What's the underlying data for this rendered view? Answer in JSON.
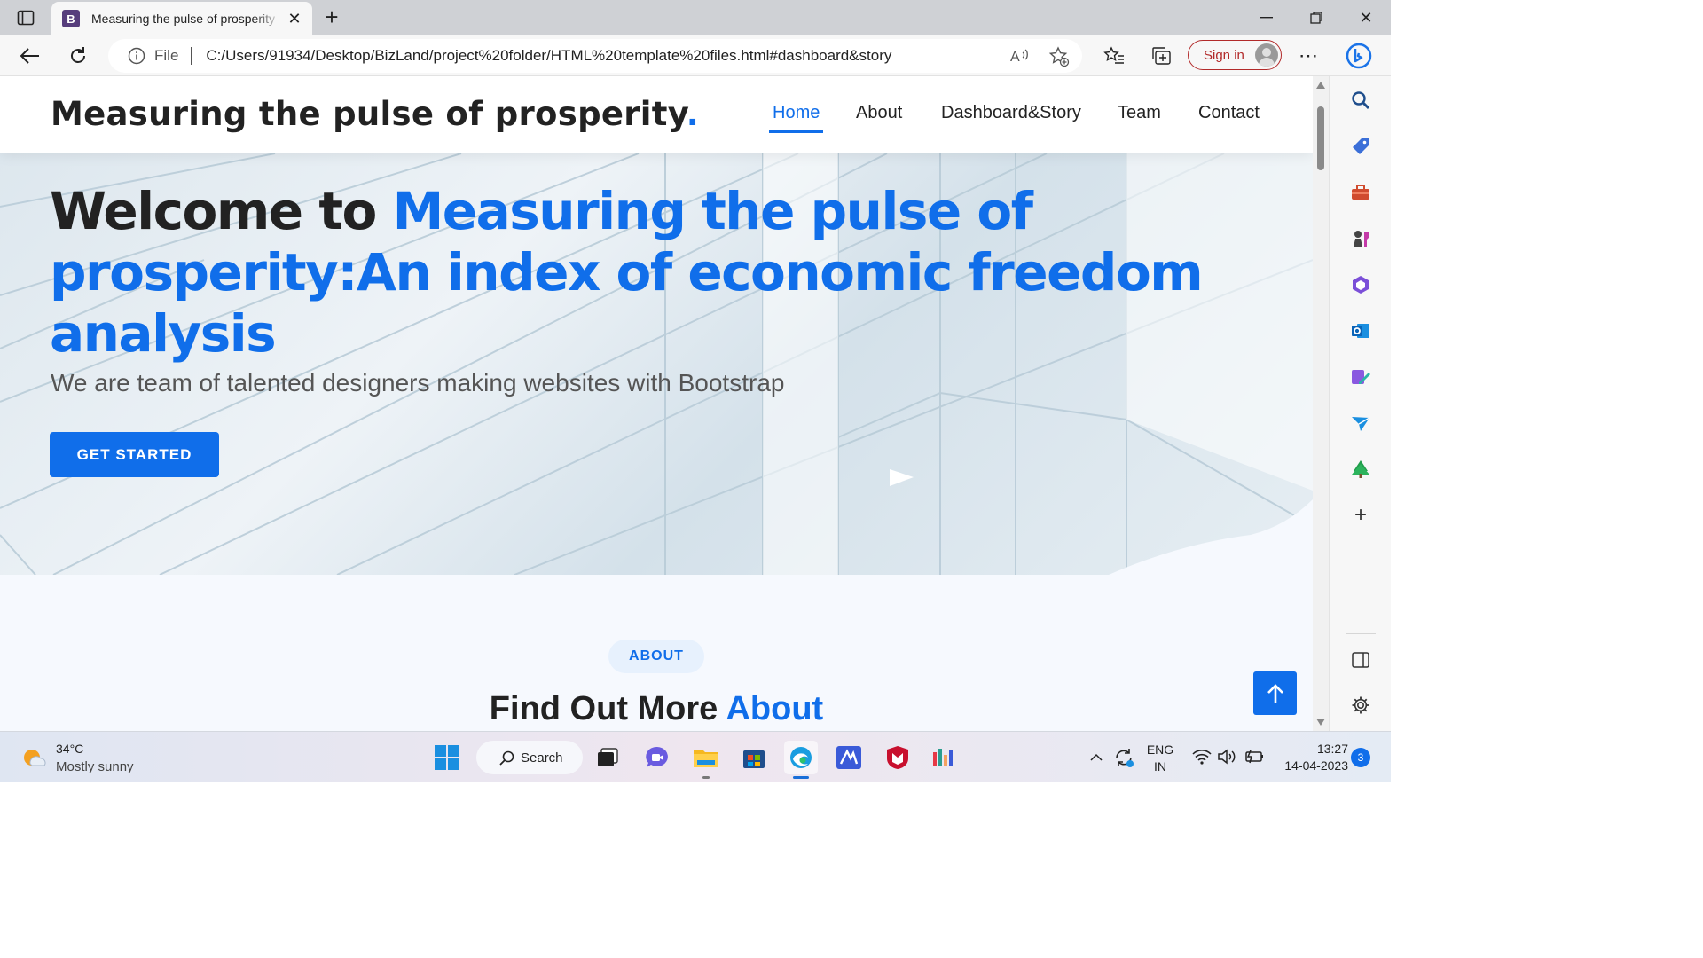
{
  "browser": {
    "tab_title": "Measuring the pulse of prosperity",
    "tab_favicon_letter": "B",
    "url_scheme_label": "File",
    "url": "C:/Users/91934/Desktop/BizLand/project%20folder/HTML%20template%20files.html#dashboard&story",
    "sign_in_label": "Sign in"
  },
  "site": {
    "logo_text": "Measuring the pulse of prosperity",
    "logo_dot": ".",
    "nav": [
      "Home",
      "About",
      "Dashboard&Story",
      "Team",
      "Contact"
    ],
    "active_nav": "Home"
  },
  "hero": {
    "title_prefix": "Welcome to ",
    "title_highlight": "Measuring the pulse of prosperity:An index of economic freedom analysis",
    "subtitle": "We are team of talented designers making websites with Bootstrap",
    "cta_label": "GET STARTED"
  },
  "about": {
    "badge": "ABOUT",
    "title_prefix": "Find Out More ",
    "title_highlight": "About"
  },
  "taskbar": {
    "temperature": "34°C",
    "weather": "Mostly sunny",
    "search_label": "Search",
    "language": "ENG",
    "region": "IN",
    "time": "13:27",
    "date": "14-04-2023",
    "notification_count": "3"
  },
  "colors": {
    "accent": "#106eea",
    "heading": "#222222",
    "signin_red": "#b22a2a"
  },
  "icons": {
    "sidebar": [
      "search-icon",
      "tag-icon",
      "toolbox-icon",
      "chess-icon",
      "copilot-icon",
      "outlook-icon",
      "designer-icon",
      "send-icon",
      "tree-icon",
      "add-icon",
      "split-view-icon",
      "settings-icon"
    ]
  }
}
